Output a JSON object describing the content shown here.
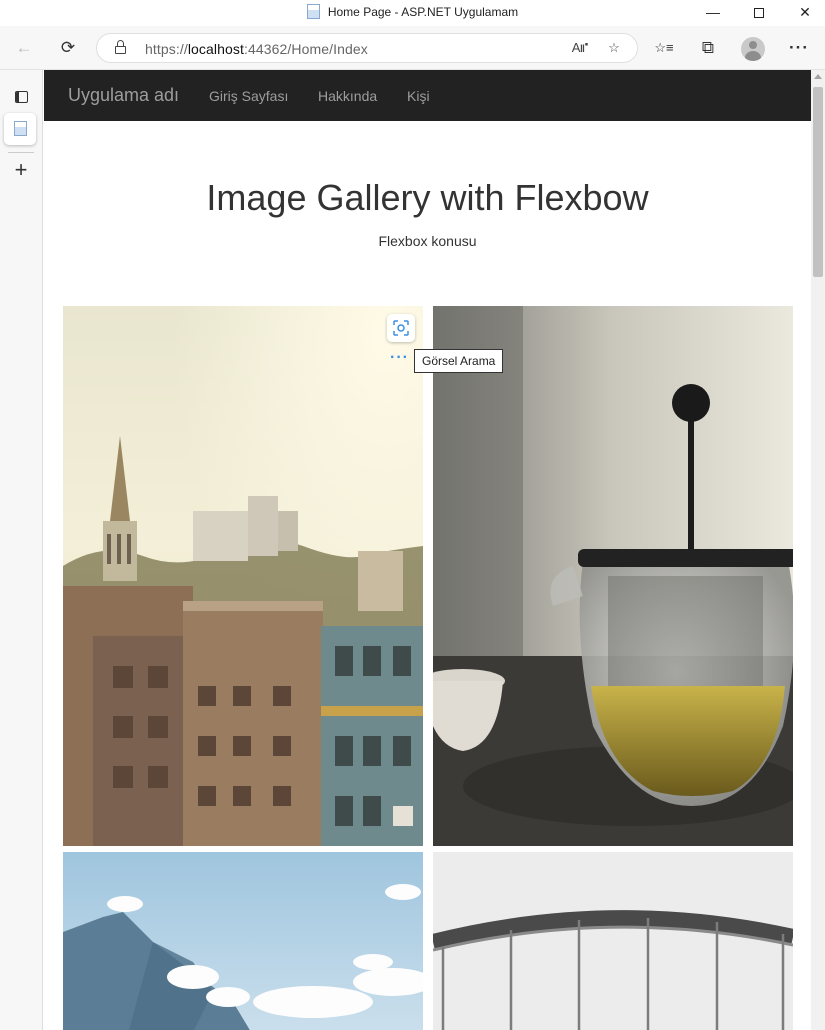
{
  "window": {
    "title": "Home Page - ASP.NET Uygulamam",
    "minimize": "—",
    "close": "✕"
  },
  "toolbar": {
    "back_icon": "←",
    "refresh_icon": "⟳",
    "url_scheme": "https://",
    "url_host": "localhost",
    "url_rest": ":44362/Home/Index",
    "read_aloud_icon": "A⑈",
    "add_favorite_icon": "☆",
    "favorites_icon": "☆≡",
    "collections_icon": "⧉",
    "more_icon": "···"
  },
  "sidebar": {
    "new_tab_icon": "+"
  },
  "site": {
    "brand": "Uygulama adı",
    "nav": [
      "Giriş Sayfası",
      "Hakkında",
      "Kişi"
    ]
  },
  "main": {
    "title": "Image Gallery with Flexbow",
    "subtitle": "Flexbox konusu"
  },
  "gallery": {
    "images": [
      "city",
      "teapot",
      "mountain",
      "bridge"
    ]
  },
  "image_overlay": {
    "more_icon": "···",
    "tooltip": "Görsel Arama"
  },
  "colors": {
    "navbar_bg": "#222222",
    "nav_text": "#9d9d9d",
    "accent": "#3a8ee6"
  }
}
